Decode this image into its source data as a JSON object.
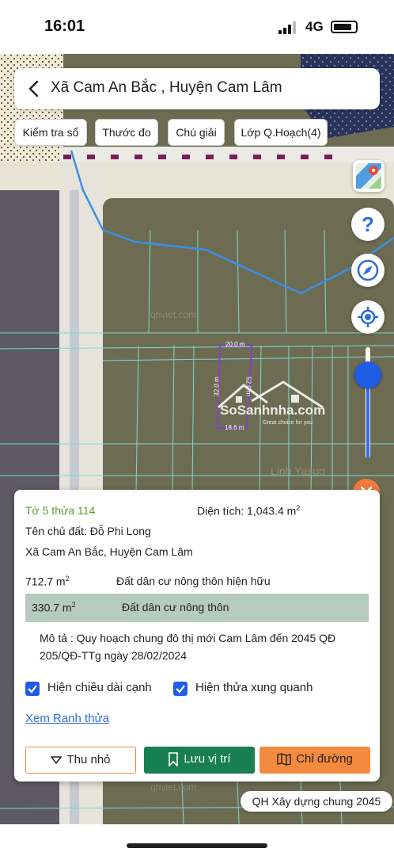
{
  "status_bar": {
    "time": "16:01",
    "network": "4G"
  },
  "header": {
    "title": "Xã Cam An Bắc , Huyện Cam Lâm"
  },
  "toolbar": {
    "check_label": "Kiểm tra sổ",
    "measure_label": "Thước đo",
    "legend_label": "Chú giải",
    "layer_label": "Lớp Q.Hoạch(4)"
  },
  "map": {
    "watermark_1": "qhviet.com",
    "watermark_2": "qhviet.com",
    "edge_top": "20.0 m",
    "edge_left": "32.0 m",
    "edge_right": "52.0 m",
    "edge_bottom": "18.6 m",
    "brand_logo": "SoSanhnha.com",
    "brand_tagline": "Great choice for you",
    "place_label": "Linh Yasuo",
    "zoom_level": 0.25,
    "plan_badge": "QH Xây dựng chung 2045"
  },
  "panel": {
    "parcel_id": "Tờ 5 thửa 114",
    "area_label": "Diện tích: 1,043.4 m",
    "area_sup": "2",
    "owner": "Tên chủ đất: Đỗ Phi Long",
    "address": "Xã Cam An Bắc, Huyện Cam Lâm",
    "land_uses": [
      {
        "value": "712.7 m",
        "sup": "2",
        "type": "Đất dân cư nông thôn hiện hữu"
      },
      {
        "value": "330.7 m",
        "sup": "2",
        "type": "Đất dân cư nông thôn"
      }
    ],
    "description": "Mô tả : Quy hoạch chung đô thị mới Cam Lâm đến 2045 QĐ 205/QĐ-TTg ngày 28/02/2024",
    "show_edge_lengths": "Hiện chiều dài cạnh",
    "show_neighbors": "Hiện thửa xung quanh",
    "view_boundary": "Xem Ranh thửa",
    "minimize": "Thu nhỏ",
    "save_location": "Lưu vị trí",
    "directions": "Chỉ đường"
  },
  "colors": {
    "accent_blue": "#1f5de8",
    "save_green": "#188050",
    "directions_orange": "#f38a3e",
    "parcel_green": "#5a9a2a",
    "map_olive": "#6d6c52"
  }
}
